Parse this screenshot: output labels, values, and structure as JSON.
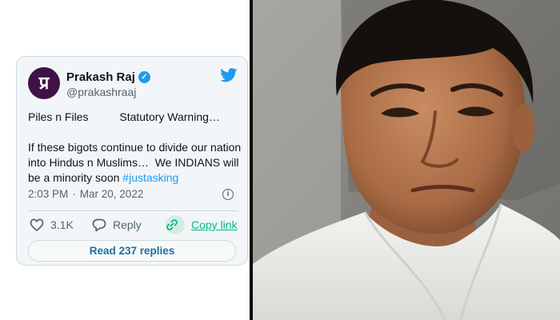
{
  "tweet": {
    "avatar_glyph": "प्र",
    "display_name": "Prakash Raj",
    "handle": "@prakashraaj",
    "lines": [
      "Piles n Files          Statutory Warning…",
      "If these bigots continue to divide our nation",
      "into Hindus n Muslims…  We INDIANS will",
      "be a minority soon "
    ],
    "hashtag": "#justasking",
    "time": "2:03 PM",
    "date_separator": "·",
    "date": "Mar 20, 2022",
    "like_count": "3.1K",
    "reply_label": "Reply",
    "copy_link_label": "Copy link",
    "read_replies_label": "Read 237 replies"
  },
  "colors": {
    "brand_blue": "#1d9bf0",
    "copy_green": "#00ba7c",
    "card_background": "#f2f6f9",
    "avatar_background": "#3f1245"
  },
  "icons": [
    "verified-icon",
    "twitter-bird-icon",
    "info-icon",
    "heart-icon",
    "reply-bubble-icon",
    "link-icon"
  ]
}
